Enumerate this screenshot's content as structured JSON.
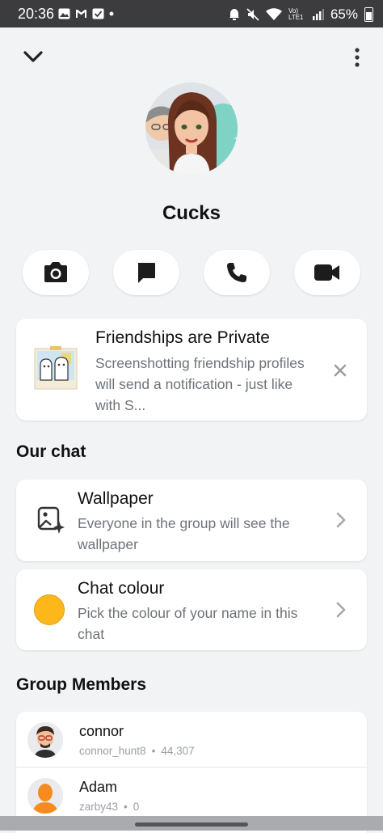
{
  "status_bar": {
    "time": "20:36",
    "battery": "65%",
    "network": "Vo) LTE1"
  },
  "header": {
    "group_name": "Cucks"
  },
  "actions": [
    {
      "icon": "camera-icon"
    },
    {
      "icon": "chat-icon"
    },
    {
      "icon": "phone-icon"
    },
    {
      "icon": "video-icon"
    }
  ],
  "privacy_card": {
    "title": "Friendships are Private",
    "description": "Screenshotting friendship profiles will send a notification - just like with S..."
  },
  "our_chat": {
    "section_title": "Our chat",
    "wallpaper": {
      "title": "Wallpaper",
      "description": "Everyone in the group will see the wallpaper"
    },
    "chat_colour": {
      "title": "Chat colour",
      "description": "Pick the colour of your name in this chat",
      "swatch_color": "#fdb71a"
    }
  },
  "group_members": {
    "section_title": "Group Members",
    "members": [
      {
        "name": "connor",
        "username": "connor_hunt8",
        "score": "44,307"
      },
      {
        "name": "Adam",
        "username": "zarby43",
        "score": "0"
      }
    ]
  },
  "colors": {
    "background": "#f2f3f5",
    "card": "#ffffff",
    "accent_yellow": "#fdb71a",
    "status_bar": "#3c3c3e"
  }
}
